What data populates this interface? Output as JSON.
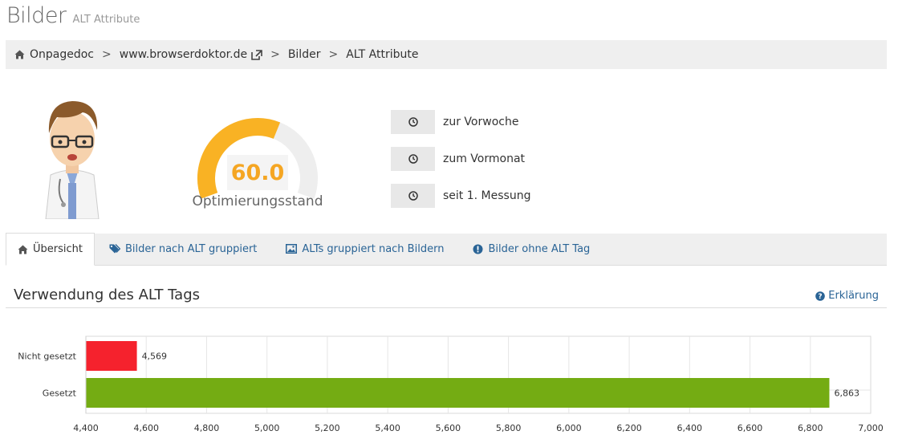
{
  "page": {
    "title": "Bilder",
    "subtitle": "ALT Attribute"
  },
  "breadcrumb": {
    "items": [
      "Onpagedoc",
      "www.browserdoktor.de",
      "Bilder",
      "ALT Attribute"
    ],
    "separator": ">"
  },
  "gauge": {
    "value": "60.0",
    "fraction": 0.6,
    "label": "Optimierungsstand",
    "color": "#f9b224",
    "track_color": "#eeeeee"
  },
  "comparison": {
    "items": [
      {
        "icon": "clock-icon",
        "label": "zur Vorwoche"
      },
      {
        "icon": "clock-icon",
        "label": "zum Vormonat"
      },
      {
        "icon": "clock-icon",
        "label": "seit 1. Messung"
      }
    ]
  },
  "tabs": [
    {
      "icon": "home-icon",
      "label": "Übersicht",
      "active": true
    },
    {
      "icon": "tags-icon",
      "label": "Bilder nach ALT gruppiert",
      "active": false
    },
    {
      "icon": "image-icon",
      "label": "ALTs gruppiert nach Bildern",
      "active": false
    },
    {
      "icon": "exclamation-icon",
      "label": "Bilder ohne ALT Tag",
      "active": false
    }
  ],
  "section": {
    "title": "Verwendung des ALT Tags",
    "help": "Erklärung"
  },
  "colors": {
    "link": "#2a6496",
    "bar_not_set": "#f5222d",
    "bar_set": "#74ac13",
    "accent": "#f5a623"
  },
  "chart_data": {
    "type": "bar",
    "orientation": "horizontal",
    "categories": [
      "Nicht gesetzt",
      "Gesetzt"
    ],
    "values": [
      4569,
      6863
    ],
    "value_labels": [
      "4,569",
      "6,863"
    ],
    "xlim": [
      4400,
      7000
    ],
    "xticks": [
      4400,
      4600,
      4800,
      5000,
      5200,
      5400,
      5600,
      5800,
      6000,
      6200,
      6400,
      6600,
      6800,
      7000
    ],
    "xtick_labels": [
      "4,400",
      "4,600",
      "4,800",
      "5,000",
      "5,200",
      "5,400",
      "5,600",
      "5,800",
      "6,000",
      "6,200",
      "6,400",
      "6,600",
      "6,800",
      "7,000"
    ],
    "grid": true,
    "colors": [
      "#f5222d",
      "#74ac13"
    ]
  }
}
